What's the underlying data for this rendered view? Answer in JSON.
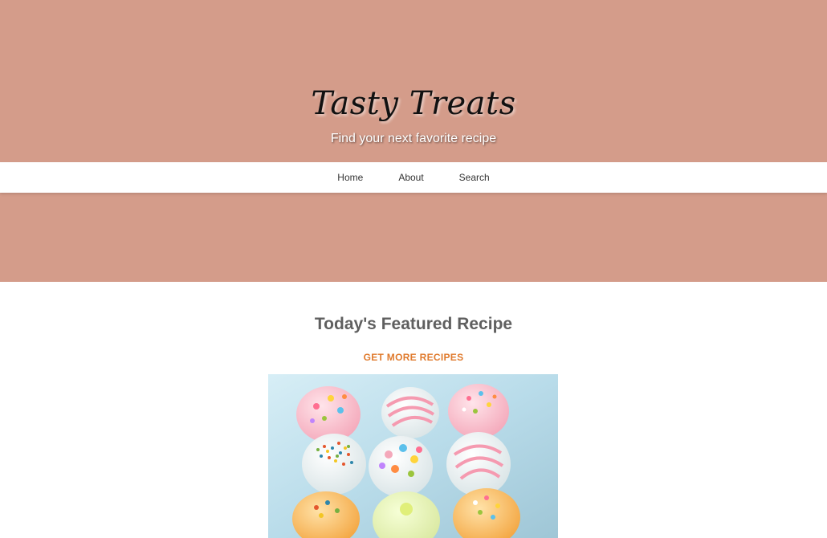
{
  "header": {
    "title": "Tasty Treats",
    "tagline": "Find your next favorite recipe"
  },
  "nav": {
    "items": [
      {
        "label": "Home"
      },
      {
        "label": "About"
      },
      {
        "label": "Search"
      }
    ]
  },
  "featured": {
    "heading": "Today's Featured Recipe",
    "more_link": "GET MORE RECIPES",
    "image_icon": "cake-pops-photo"
  },
  "colors": {
    "hero_background": "#d49c8a",
    "link_accent": "#e07b2e",
    "heading_text": "#5f5f5f"
  }
}
